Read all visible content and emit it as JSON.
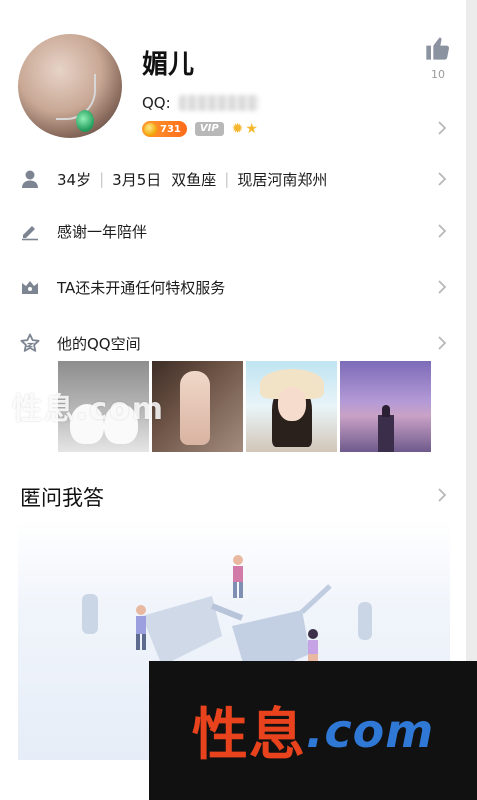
{
  "profile": {
    "nickname": "媚儿",
    "qq_label": "QQ:",
    "coin_value": "731",
    "vip_label": "VIP",
    "like_count": "10"
  },
  "info_row": {
    "age": "34岁",
    "birthday": "3月5日",
    "zodiac": "双鱼座",
    "location": "现居河南郑州"
  },
  "signature_row": {
    "text": "感谢一年陪伴"
  },
  "privilege_row": {
    "text": "TA还未开通任何特权服务"
  },
  "qzone_row": {
    "text": "他的QQ空间"
  },
  "anon_qa": {
    "title": "匿问我答"
  },
  "watermark": {
    "left": "性息",
    "right": ".com"
  },
  "colors": {
    "accent_orange": "#e8431d",
    "accent_blue": "#2f78d6",
    "icon_gray": "#7d8592",
    "chevron_gray": "#b8b8b8"
  },
  "icons": {
    "like": "thumbs-up-icon",
    "person": "person-icon",
    "edit": "pencil-icon",
    "privilege": "crown-box-icon",
    "qzone": "star-icon",
    "chevron": "chevron-right-icon"
  }
}
